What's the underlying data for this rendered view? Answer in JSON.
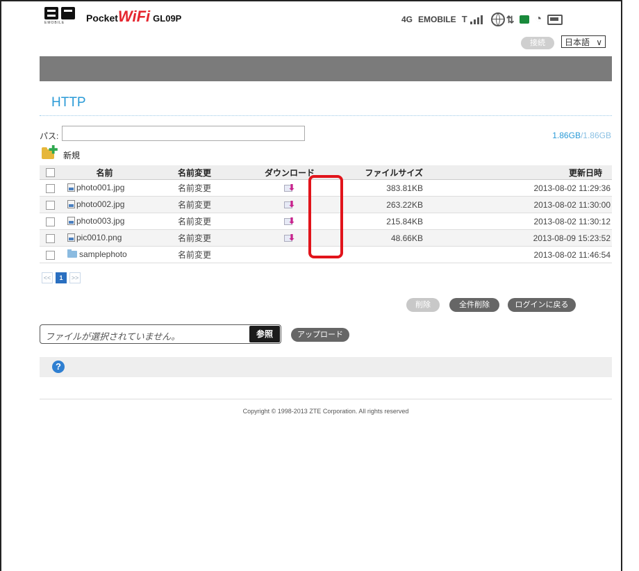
{
  "header": {
    "logo_sub": "EMOBILE",
    "brand_pocket": "Pocket",
    "brand_wifi": "WiFi",
    "model": "GL09P",
    "network_type": "4G",
    "carrier": "EMOBILE",
    "connect_label": "接続",
    "language": "日本語"
  },
  "page": {
    "title": "HTTP",
    "path_label": "パス:",
    "path_value": "",
    "storage_used": "1.86GB",
    "storage_sep": "/",
    "storage_total": "1.86GB",
    "new_label": "新規"
  },
  "table": {
    "headers": {
      "name": "名前",
      "rename": "名前変更",
      "download": "ダウンロード",
      "size": "ファイルサイズ",
      "modified": "更新日時"
    },
    "rows": [
      {
        "name": "photo001.jpg",
        "type": "file",
        "rename": "名前変更",
        "size": "383.81KB",
        "date": "2013-08-02 11:29:36"
      },
      {
        "name": "photo002.jpg",
        "type": "file",
        "rename": "名前変更",
        "size": "263.22KB",
        "date": "2013-08-02 11:30:00"
      },
      {
        "name": "photo003.jpg",
        "type": "file",
        "rename": "名前変更",
        "size": "215.84KB",
        "date": "2013-08-02 11:30:12"
      },
      {
        "name": "pic0010.png",
        "type": "file",
        "rename": "名前変更",
        "size": "48.66KB",
        "date": "2013-08-09 15:23:52"
      },
      {
        "name": "samplephoto",
        "type": "folder",
        "rename": "名前変更",
        "size": "",
        "date": "2013-08-02 11:46:54"
      }
    ]
  },
  "pager": {
    "prev": "<<",
    "current": "1",
    "next": ">>"
  },
  "actions": {
    "delete": "削除",
    "delete_all": "全件削除",
    "back_to_login": "ログインに戻る"
  },
  "upload": {
    "file_placeholder": "ファイルが選択されていません。",
    "browse": "参照",
    "upload": "アップロード"
  },
  "help_icon": "?",
  "footer": {
    "copyright": "Copyright © 1998-2013 ZTE Corporation. All rights reserved"
  },
  "colors": {
    "accent": "#2a9ad7",
    "highlight": "#e1141b",
    "nav_band": "#7b7b7b"
  }
}
